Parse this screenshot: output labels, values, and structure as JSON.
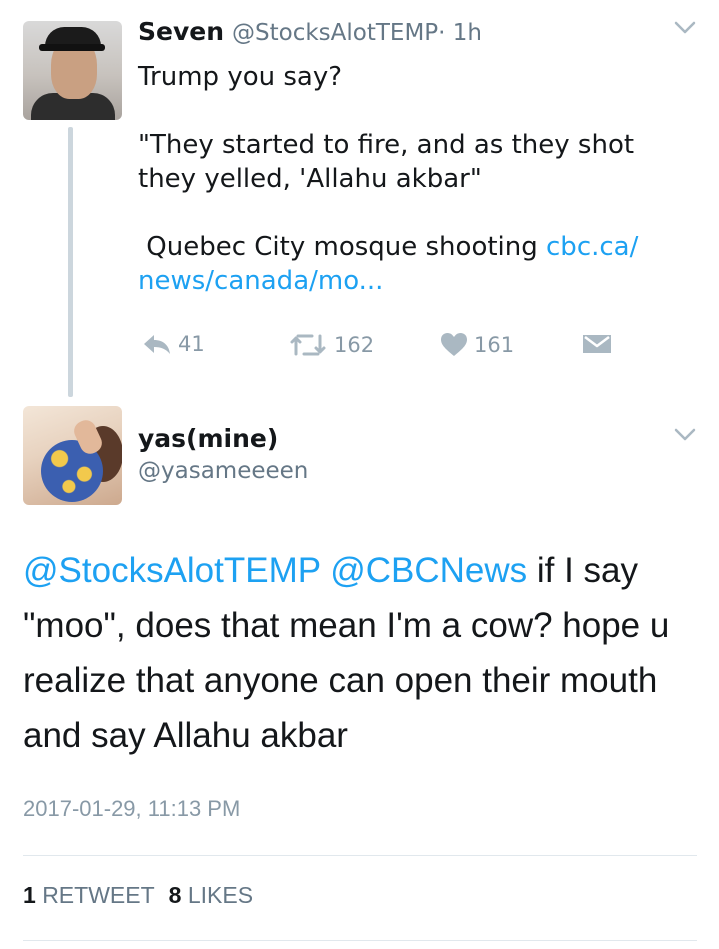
{
  "tweet1": {
    "name": "Seven",
    "handle": "@StocksAlotTEMP",
    "time": "· 1h",
    "line1": "Trump you say?",
    "line2": "\"They started to fire, and as they shot they yelled, 'Allahu akbar\"",
    "line3_text": " Quebec City mosque shooting ",
    "line3_link": "cbc.ca/ news/canada/mo...",
    "replies": "41",
    "retweets": "162",
    "likes": "161"
  },
  "tweet2": {
    "name": "yas(mine)",
    "handle": "@yasameeeen",
    "mention1": "@StocksAlotTEMP",
    "mention2": "@CBCNews",
    "body": " if I say \"moo\", does that mean I'm a cow? hope u realize that anyone can open their mouth and say Allahu akbar",
    "timestamp": "2017-01-29, 11:13 PM",
    "retweet_count": "1",
    "retweet_label": "RETWEET",
    "like_count": "8",
    "like_label": "LIKES"
  },
  "icons": {
    "reply": "reply-icon",
    "retweet": "retweet-icon",
    "like": "heart-icon",
    "dm": "envelope-icon",
    "menu": "chevron-down-icon"
  },
  "colors": {
    "link": "#1da1f2",
    "muted": "#8899a6",
    "thread_line": "#ccd6dd"
  }
}
